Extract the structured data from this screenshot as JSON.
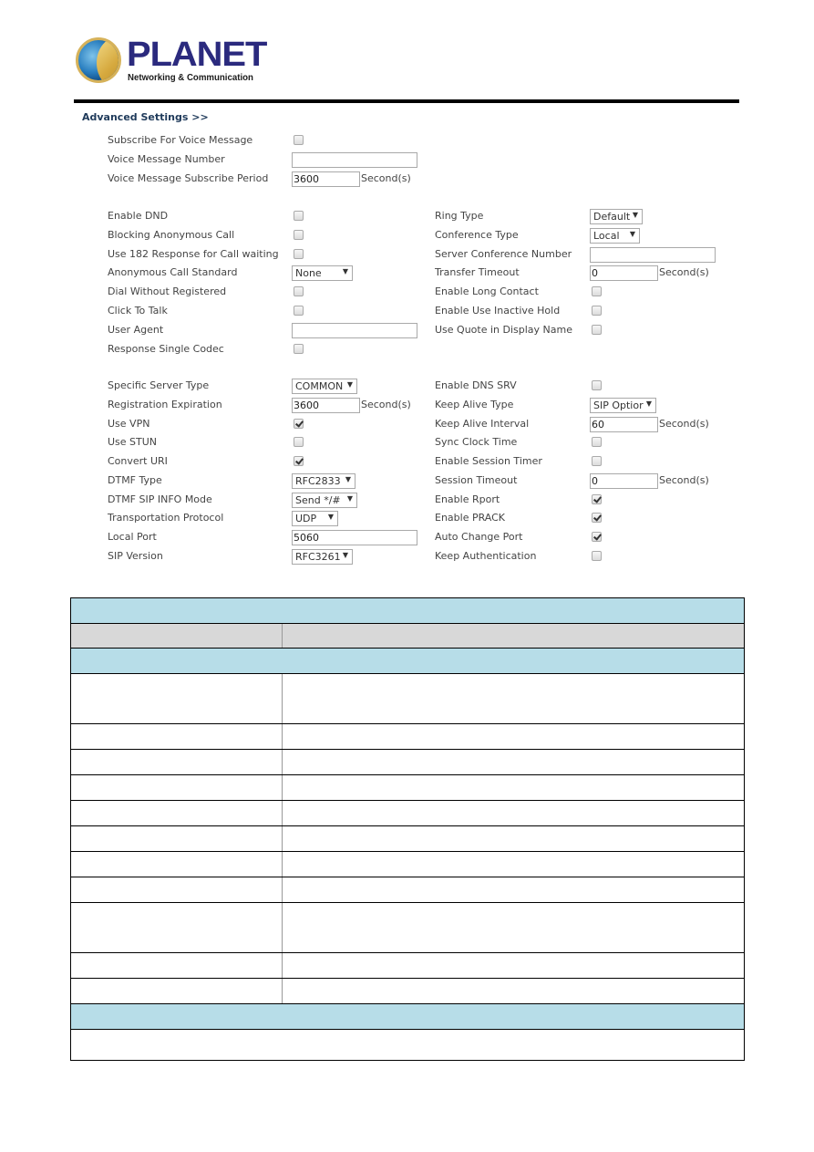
{
  "brand": {
    "name": "PLANET",
    "tagline": "Networking & Communication"
  },
  "advanced": {
    "title": "Advanced Settings >>",
    "second_unit": "Second(s)",
    "voice": [
      {
        "label": "Subscribe For Voice Message",
        "type": "checkbox",
        "checked": false
      },
      {
        "label": "Voice Message Number",
        "type": "text",
        "value": ""
      },
      {
        "label": "Voice Message Subscribe Period",
        "type": "text",
        "value": "3600",
        "unit": "Second(s)"
      }
    ],
    "left_group2": [
      {
        "label": "Enable DND",
        "type": "checkbox",
        "checked": false
      },
      {
        "label": "Blocking Anonymous Call",
        "type": "checkbox",
        "checked": false
      },
      {
        "label": "Use 182 Response for Call waiting",
        "type": "checkbox",
        "checked": false
      },
      {
        "label": "Anonymous Call Standard",
        "type": "select",
        "value": "None"
      },
      {
        "label": "Dial Without Registered",
        "type": "checkbox",
        "checked": false
      },
      {
        "label": "Click To Talk",
        "type": "checkbox",
        "checked": false
      },
      {
        "label": "User Agent",
        "type": "text",
        "value": ""
      },
      {
        "label": "Response Single Codec",
        "type": "checkbox",
        "checked": false
      }
    ],
    "right_group2": [
      {
        "label": "Ring Type",
        "type": "select",
        "value": "Default"
      },
      {
        "label": "Conference Type",
        "type": "select",
        "value": "Local"
      },
      {
        "label": "Server Conference Number",
        "type": "text",
        "value": ""
      },
      {
        "label": "Transfer Timeout",
        "type": "text",
        "value": "0",
        "unit": "Second(s)"
      },
      {
        "label": "Enable Long Contact",
        "type": "checkbox",
        "checked": false
      },
      {
        "label": "Enable Use Inactive Hold",
        "type": "checkbox",
        "checked": false
      },
      {
        "label": "Use Quote in Display Name",
        "type": "checkbox",
        "checked": false
      }
    ],
    "left_group3": [
      {
        "label": "Specific Server Type",
        "type": "select",
        "value": "COMMON"
      },
      {
        "label": "Registration Expiration",
        "type": "text",
        "value": "3600",
        "unit": "Second(s)"
      },
      {
        "label": "Use VPN",
        "type": "checkbox",
        "checked": true
      },
      {
        "label": "Use STUN",
        "type": "checkbox",
        "checked": false
      },
      {
        "label": "Convert URI",
        "type": "checkbox",
        "checked": true
      },
      {
        "label": "DTMF Type",
        "type": "select",
        "value": "RFC2833"
      },
      {
        "label": "DTMF SIP INFO Mode",
        "type": "select",
        "value": "Send */#"
      },
      {
        "label": "Transportation Protocol",
        "type": "select",
        "value": "UDP"
      },
      {
        "label": "Local Port",
        "type": "text",
        "value": "5060"
      },
      {
        "label": "SIP Version",
        "type": "select",
        "value": "RFC3261"
      }
    ],
    "right_group3": [
      {
        "label": "Enable DNS SRV",
        "type": "checkbox",
        "checked": false
      },
      {
        "label": "Keep Alive Type",
        "type": "select",
        "value": "SIP Optior"
      },
      {
        "label": "Keep Alive Interval",
        "type": "text",
        "value": "60",
        "unit": "Second(s)"
      },
      {
        "label": "Sync Clock Time",
        "type": "checkbox",
        "checked": false
      },
      {
        "label": "Enable Session Timer",
        "type": "checkbox",
        "checked": false
      },
      {
        "label": "Session Timeout",
        "type": "text",
        "value": "0",
        "unit": "Second(s)"
      },
      {
        "label": "Enable Rport",
        "type": "checkbox",
        "checked": true
      },
      {
        "label": "Enable PRACK",
        "type": "checkbox",
        "checked": true
      },
      {
        "label": "Auto Change Port",
        "type": "checkbox",
        "checked": true
      },
      {
        "label": "Keep Authentication",
        "type": "checkbox",
        "checked": false
      }
    ]
  },
  "table": {
    "header_color": "#b7dde8",
    "subheader_color": "#d8d8d8"
  }
}
